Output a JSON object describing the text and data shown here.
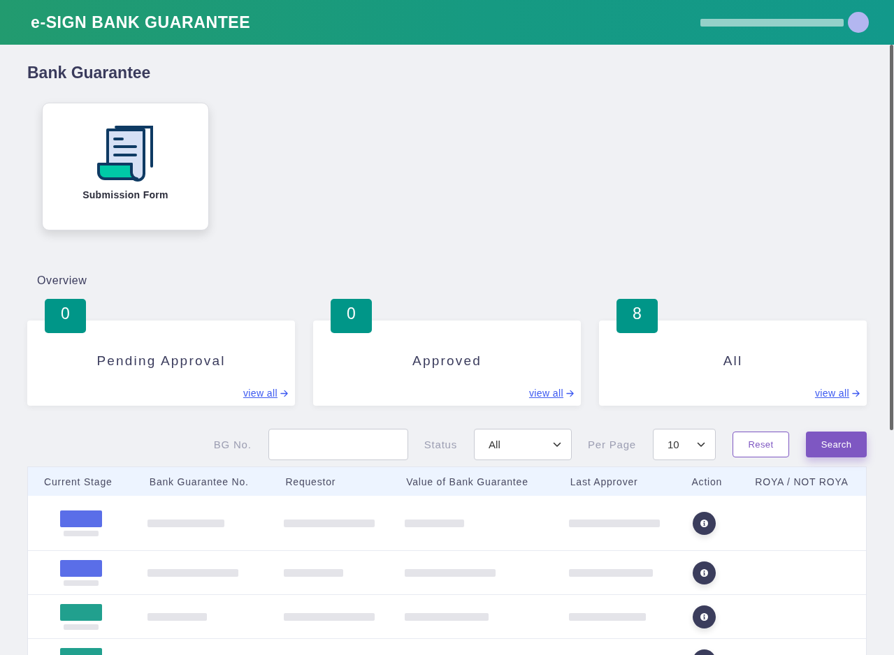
{
  "header": {
    "title": "e-SIGN BANK GUARANTEE"
  },
  "page": {
    "title": "Bank Guarantee"
  },
  "shortcuts": [
    {
      "label": "Submission Form"
    }
  ],
  "overview": {
    "title": "Overview",
    "cards": [
      {
        "count": "0",
        "label": "Pending Approval",
        "link": "view all"
      },
      {
        "count": "0",
        "label": "Approved",
        "link": "view all"
      },
      {
        "count": "8",
        "label": "All",
        "link": "view all"
      }
    ]
  },
  "filters": {
    "fields": [
      {
        "label": "BG No.",
        "kind": "text"
      },
      {
        "label": "Status",
        "kind": "select",
        "value": "All"
      },
      {
        "label": "Per Page",
        "kind": "select",
        "value": "10"
      }
    ],
    "buttons": [
      {
        "label": "Reset",
        "kind": "outline"
      },
      {
        "label": "Search",
        "kind": "primary"
      }
    ]
  },
  "table": {
    "columns": [
      "Current Stage",
      "Bank Guarantee No.",
      "Requestor",
      "Value of Bank Guarantee",
      "Last Approver",
      "Action",
      "ROYA / NOT ROYA"
    ],
    "rows": [
      {
        "color": "#5a6ee8"
      },
      {
        "color": "#5a6ee8"
      },
      {
        "color": "#21a08e"
      },
      {
        "color": "#21a08e"
      }
    ]
  }
}
